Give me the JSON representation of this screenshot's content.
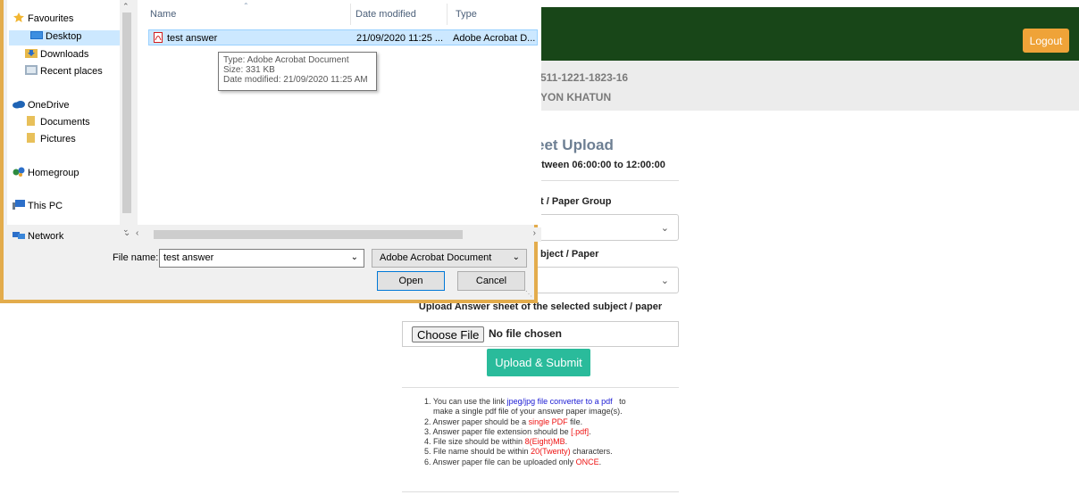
{
  "page": {
    "logout_label": "Logout",
    "info_line1": "511-1221-1823-16",
    "info_line2": "YON KHATUN",
    "heading": "eet Upload",
    "subheading": "etween 06:00:00 to 12:00:00",
    "label_group": "t / Paper Group",
    "select_group_value": "",
    "label_subject": "bject / Paper",
    "select_subject_value": ")",
    "label_upload": "Upload Answer sheet of the selected subject / paper",
    "choose_file_label": "Choose File",
    "no_file_text": "No file chosen",
    "submit_label": "Upload & Submit",
    "notes": {
      "n1_prefix": "1. You can use the link ",
      "n1_link": "jpeg/jpg file converter to a pdf",
      "n1_suffix": "to",
      "n1_cont": "make a single pdf file of your answer paper image(s).",
      "n2_prefix": "2. Answer paper should be a ",
      "n2_hl": "single PDF",
      "n2_suffix": " file.",
      "n3_prefix": "3. Answer paper file extension should be ",
      "n3_hl": "[.pdf]",
      "n3_suffix": ".",
      "n4_prefix": "4. File size should be within ",
      "n4_hl": "8(Eight)MB",
      "n4_suffix": ".",
      "n5_prefix": "5. File name should be within ",
      "n5_hl": "20(Twenty)",
      "n5_suffix": " characters.",
      "n6_prefix": "6. Answer paper file can be uploaded only ",
      "n6_hl": "ONCE",
      "n6_suffix": "."
    },
    "colors": {
      "topbar": "#184618",
      "logout": "#efa338",
      "submit": "#2abb9b",
      "link": "#1b1bd4",
      "highlight": "#e11111"
    }
  },
  "dialog": {
    "nav_items": [
      {
        "label": "Favourites",
        "icon": "star-icon"
      },
      {
        "label": "Desktop",
        "icon": "desktop-icon",
        "selected": true
      },
      {
        "label": "Downloads",
        "icon": "downloads-folder-icon"
      },
      {
        "label": "Recent places",
        "icon": "recent-places-icon"
      },
      {
        "label": "OneDrive",
        "icon": "cloud-icon"
      },
      {
        "label": "Documents",
        "icon": "folder-icon"
      },
      {
        "label": "Pictures",
        "icon": "folder-icon"
      },
      {
        "label": "Homegroup",
        "icon": "homegroup-icon"
      },
      {
        "label": "This PC",
        "icon": "computer-icon"
      },
      {
        "label": "Network",
        "icon": "network-icon"
      }
    ],
    "columns": {
      "name": "Name",
      "date": "Date modified",
      "type": "Type"
    },
    "files": [
      {
        "name": "test answer",
        "date": "21/09/2020 11:25 ...",
        "type": "Adobe Acrobat D...",
        "icon": "pdf-icon"
      }
    ],
    "tooltip": {
      "line1": "Type: Adobe Acrobat Document",
      "line2": "Size: 331 KB",
      "line3": "Date modified: 21/09/2020 11:25 AM"
    },
    "filename_label": "File name:",
    "filename_value": "test answer",
    "filetype_value": "Adobe Acrobat Document",
    "open_label": "Open",
    "cancel_label": "Cancel"
  }
}
